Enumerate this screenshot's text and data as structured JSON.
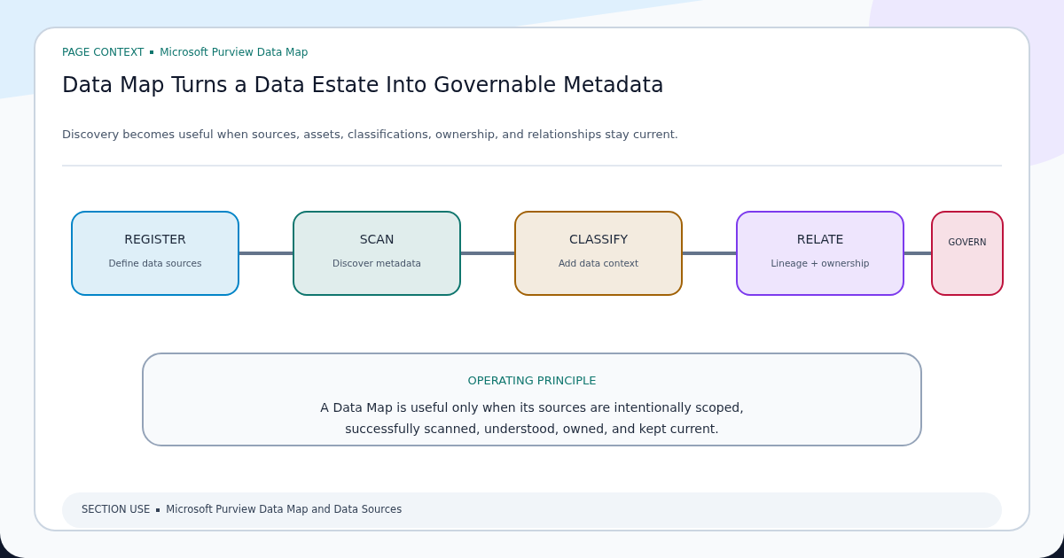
{
  "header": {
    "eyebrow_label": "PAGE CONTEXT",
    "eyebrow_value": "Microsoft Purview Data Map",
    "title": "Data Map Turns a Data Estate Into Governable Metadata",
    "subtitle": "Discovery becomes useful when sources, assets, classifications, ownership, and relationships stay current."
  },
  "steps": [
    {
      "title": "REGISTER",
      "caption": "Define data sources",
      "color": "#0284c7",
      "kind": "full"
    },
    {
      "title": "SCAN",
      "caption": "Discover metadata",
      "color": "#0f766e",
      "kind": "full"
    },
    {
      "title": "CLASSIFY",
      "caption": "Add data context",
      "color": "#a16207",
      "kind": "full"
    },
    {
      "title": "RELATE",
      "caption": "Lineage + ownership",
      "color": "#7c3aed",
      "kind": "full"
    },
    {
      "title": "GOVERN",
      "color": "#be123c",
      "kind": "compact"
    }
  ],
  "principle": {
    "label": "OPERATING PRINCIPLE",
    "lines": [
      "A Data Map is useful only when its sources are intentionally scoped,",
      "successfully scanned, understood, owned, and kept current."
    ]
  },
  "footer": {
    "label": "SECTION USE",
    "value": "Microsoft Purview Data Map and Data Sources"
  }
}
